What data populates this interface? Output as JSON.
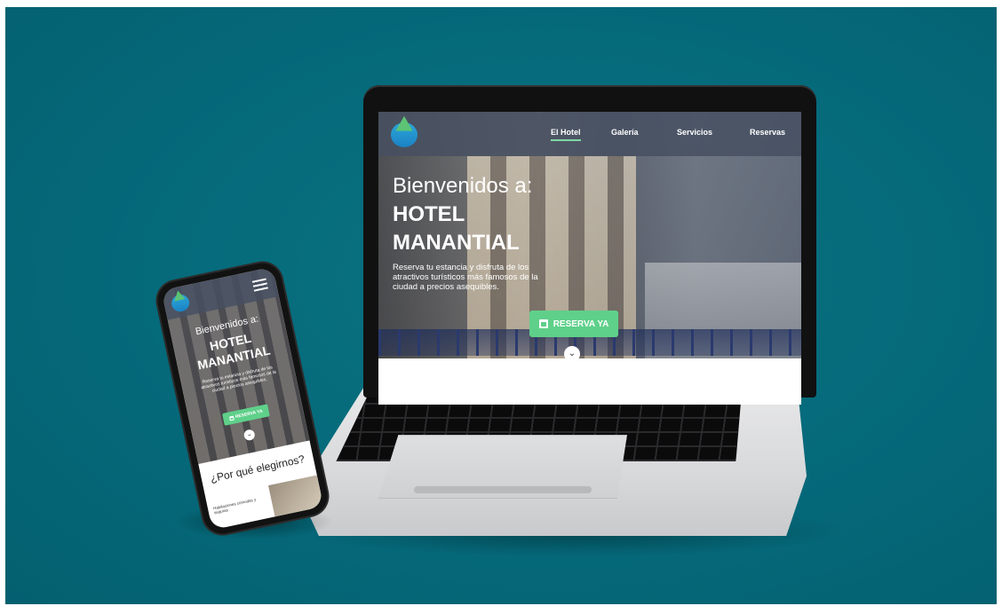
{
  "colors": {
    "background": "#05697a",
    "accent_green": "#5fd08a",
    "nav_overlay": "#465062",
    "logo_blue": "#1b82c4",
    "logo_green": "#5cc474"
  },
  "laptop_site": {
    "nav": {
      "logo_icon": "hotel-logo-icon",
      "items": [
        {
          "label": "El Hotel",
          "active": true
        },
        {
          "label": "Galería",
          "active": false
        },
        {
          "label": "Servicios",
          "active": false
        },
        {
          "label": "Reservas",
          "active": false
        }
      ]
    },
    "hero": {
      "welcome": "Bienvenidos a:",
      "title_line1": "HOTEL",
      "title_line2": "MANANTIAL",
      "description": "Reserva tu estancia y disfruta de los atractivos turísticos más famosos de la ciudad  a precios asequibles.",
      "cta_label": "RESERVA YA",
      "cta_icon": "calendar-icon",
      "scroll_icon": "chevron-down-icon"
    }
  },
  "phone_site": {
    "nav": {
      "logo_icon": "hotel-logo-icon",
      "menu_icon": "hamburger-menu-icon"
    },
    "hero": {
      "welcome": "Bienvenidos a:",
      "title_line1": "HOTEL",
      "title_line2": "MANANTIAL",
      "description": "Reserva tu estancia y disfruta de los atractivos turísticos más famosos de la ciudad  a precios asequibles.",
      "cta_label": "RESERVA YA",
      "cta_icon": "calendar-icon",
      "scroll_icon": "chevron-down-icon"
    },
    "section": {
      "heading": "¿Por qué elegirnos?",
      "feature_text": "Habitaciones cómodas y seguras"
    }
  }
}
